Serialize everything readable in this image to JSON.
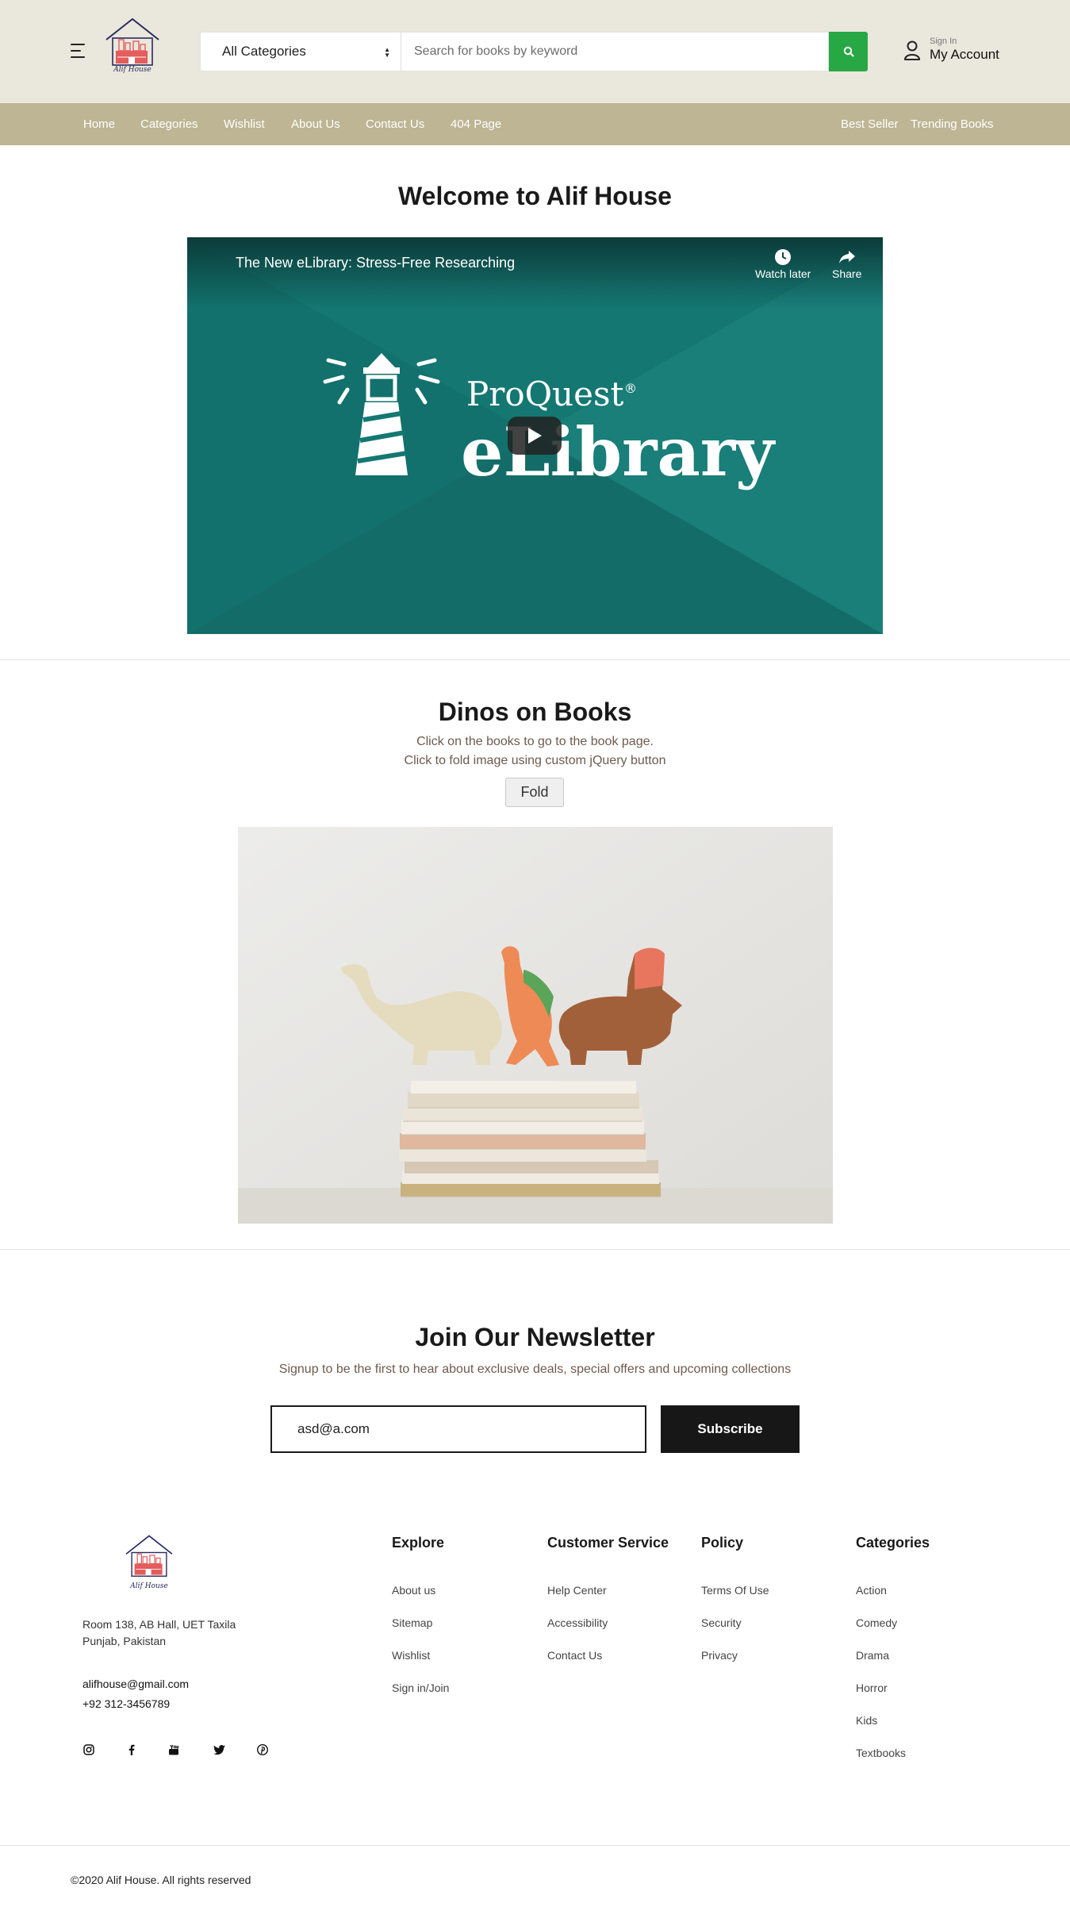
{
  "header": {
    "logo_text": "Alif House",
    "category_select": "All Categories",
    "search_placeholder": "Search for books by keyword",
    "account_small": "Sign In",
    "account_big": "My Account"
  },
  "nav": {
    "left": [
      "Home",
      "Categories",
      "Wishlist",
      "About Us",
      "Contact Us",
      "404 Page"
    ],
    "right": [
      "Best Seller",
      "Trending Books"
    ]
  },
  "welcome": {
    "title": "Welcome to Alif House",
    "video_title": "The New eLibrary: Stress-Free Researching",
    "watch_later": "Watch later",
    "share": "Share",
    "brand_top": "ProQuest",
    "brand_bottom": "eLibrary"
  },
  "dinos": {
    "title": "Dinos on Books",
    "line1": "Click on the books to go to the book page.",
    "line2": "Click to fold image using custom jQuery button",
    "fold_label": "Fold"
  },
  "newsletter": {
    "title": "Join Our Newsletter",
    "subtitle": "Signup to be the first to hear about exclusive deals, special offers and upcoming collections",
    "email_value": "asd@a.com",
    "subscribe_label": "Subscribe"
  },
  "footer": {
    "address_line1": "Room 138, AB Hall, UET Taxila",
    "address_line2": "Punjab, Pakistan",
    "email": "alifhouse@gmail.com",
    "phone": "+92 312-3456789",
    "social_icons": [
      "instagram-icon",
      "facebook-icon",
      "youtube-icon",
      "twitter-icon",
      "pinterest-icon"
    ],
    "columns": [
      {
        "title": "Explore",
        "links": [
          "About us",
          "Sitemap",
          "Wishlist",
          "Sign in/Join"
        ]
      },
      {
        "title": "Customer Service",
        "links": [
          "Help Center",
          "Accessibility",
          "Contact Us"
        ]
      },
      {
        "title": "Policy",
        "links": [
          "Terms Of Use",
          "Security",
          "Privacy"
        ]
      },
      {
        "title": "Categories",
        "links": [
          "Action",
          "Comedy",
          "Drama",
          "Horror",
          "Kids",
          "Textbooks"
        ]
      }
    ],
    "copyright": "©2020 Alif House. All rights reserved"
  },
  "colors": {
    "header_bg": "#eae7dc",
    "nav_bg": "#bdb593",
    "search_button": "#28a745",
    "video_bg": "#157772",
    "subscribe_bg": "#171717"
  }
}
